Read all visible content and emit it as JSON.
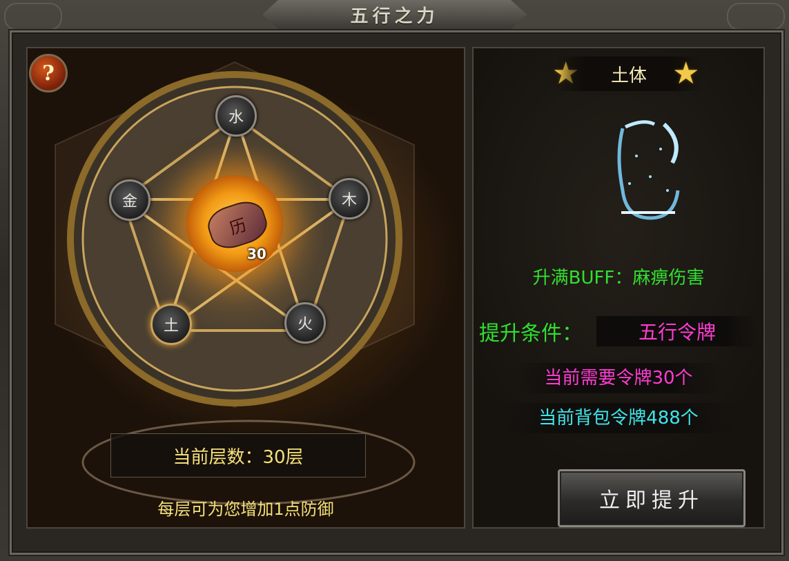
{
  "window": {
    "title": "五行之力"
  },
  "help": {
    "label": "?"
  },
  "wheel": {
    "elements": [
      {
        "key": "water",
        "label": "水"
      },
      {
        "key": "wood",
        "label": "木"
      },
      {
        "key": "fire",
        "label": "火"
      },
      {
        "key": "earth",
        "label": "土",
        "active": true
      },
      {
        "key": "metal",
        "label": "金"
      }
    ],
    "center_token_label": "历",
    "center_token_count": "30"
  },
  "layer": {
    "current": "当前层数：30层",
    "description": "每层可为您增加1点防御"
  },
  "detail": {
    "name": "土体",
    "star_icon": "star-icon",
    "buff": "升满BUFF：麻痹伤害",
    "condition_label": "提升条件：",
    "condition_value": "五行令牌",
    "need": "当前需要令牌30个",
    "bag": "当前背包令牌488个",
    "upgrade_button": "立即提升"
  },
  "colors": {
    "green": "#30e030",
    "magenta": "#ff3cd2",
    "cyan": "#3ee6ea",
    "gold": "#f5e07a"
  }
}
